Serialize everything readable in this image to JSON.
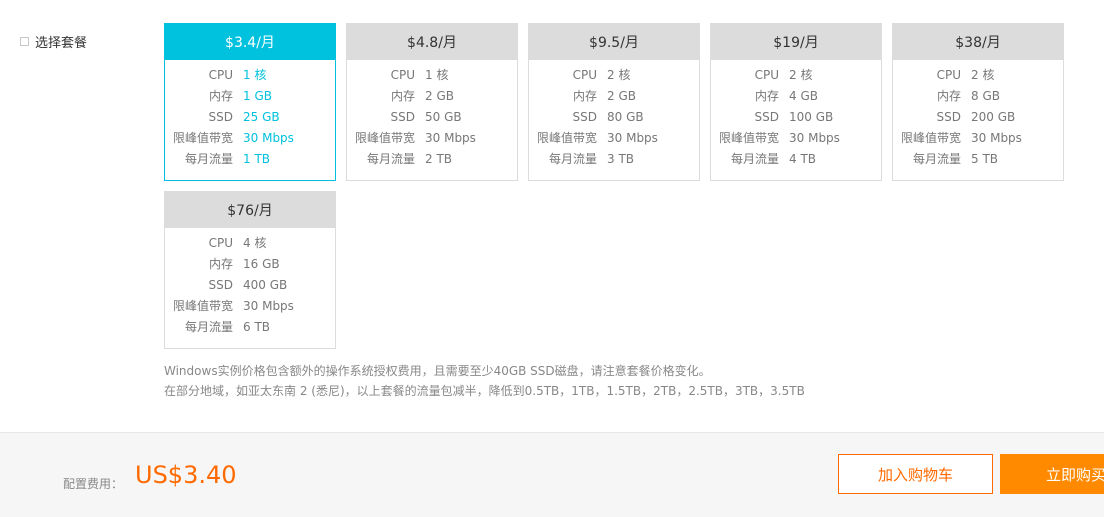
{
  "section": {
    "label": "选择套餐"
  },
  "spec_labels": {
    "cpu": "CPU",
    "mem": "内存",
    "ssd": "SSD",
    "bw": "限峰值带宽",
    "traffic": "每月流量"
  },
  "plans": [
    {
      "price": "$3.4/月",
      "cpu": "1 核",
      "mem": "1 GB",
      "ssd": "25 GB",
      "bw": "30 Mbps",
      "traffic": "1 TB",
      "selected": true
    },
    {
      "price": "$4.8/月",
      "cpu": "1 核",
      "mem": "2 GB",
      "ssd": "50 GB",
      "bw": "30 Mbps",
      "traffic": "2 TB",
      "selected": false
    },
    {
      "price": "$9.5/月",
      "cpu": "2 核",
      "mem": "2 GB",
      "ssd": "80 GB",
      "bw": "30 Mbps",
      "traffic": "3 TB",
      "selected": false
    },
    {
      "price": "$19/月",
      "cpu": "2 核",
      "mem": "4 GB",
      "ssd": "100 GB",
      "bw": "30 Mbps",
      "traffic": "4 TB",
      "selected": false
    },
    {
      "price": "$38/月",
      "cpu": "2 核",
      "mem": "8 GB",
      "ssd": "200 GB",
      "bw": "30 Mbps",
      "traffic": "5 TB",
      "selected": false
    },
    {
      "price": "$76/月",
      "cpu": "4 核",
      "mem": "16 GB",
      "ssd": "400 GB",
      "bw": "30 Mbps",
      "traffic": "6 TB",
      "selected": false
    }
  ],
  "notes": {
    "line1": "Windows实例价格包含额外的操作系统授权费用，且需要至少40GB SSD磁盘，请注意套餐价格变化。",
    "line2": "在部分地域，如亚太东南 2 (悉尼)，以上套餐的流量包减半，降低到0.5TB，1TB，1.5TB，2TB，2.5TB，3TB，3.5TB"
  },
  "footer": {
    "fee_label": "配置费用：",
    "fee_value": "US$3.40",
    "cart_label": "加入购物车",
    "buy_label": "立即购买"
  },
  "colors": {
    "accent": "#00c1de",
    "orange": "#ff6a00",
    "buy": "#ff8a00"
  }
}
